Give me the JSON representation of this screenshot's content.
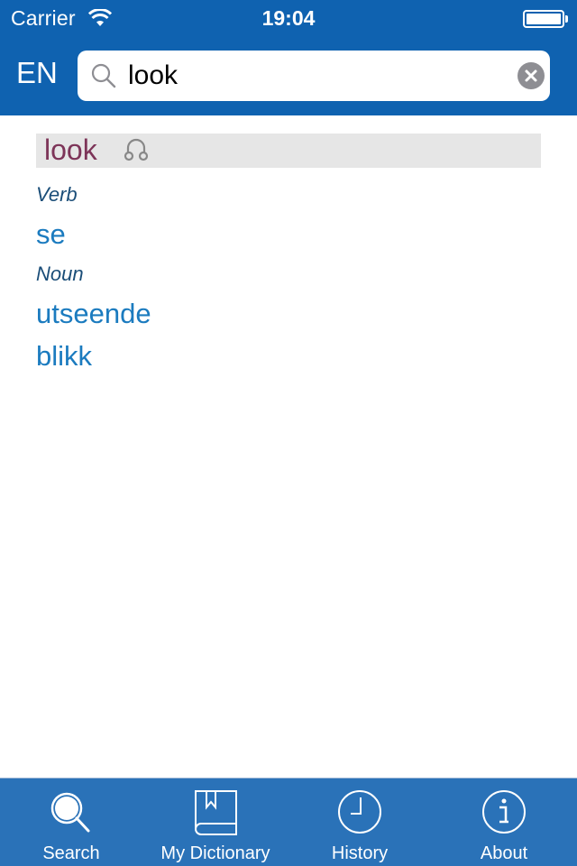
{
  "status_bar": {
    "carrier": "Carrier",
    "time": "19:04",
    "wifi_icon": "wifi-icon",
    "battery_icon": "battery-full-icon"
  },
  "header": {
    "language": "EN",
    "search": {
      "value": "look",
      "placeholder": "",
      "search_icon": "magnifier-icon",
      "clear_icon": "clear-circle-x-icon"
    }
  },
  "entry": {
    "headword": "look",
    "audio_icon": "headphones-icon",
    "senses": [
      {
        "part_of_speech": "Verb",
        "translations": [
          "se"
        ]
      },
      {
        "part_of_speech": "Noun",
        "translations": [
          "utseende",
          "blikk"
        ]
      }
    ]
  },
  "tabbar": {
    "tabs": [
      {
        "label": "Search",
        "icon": "search-icon",
        "active": true
      },
      {
        "label": "My Dictionary",
        "icon": "bookmarked-book-icon",
        "active": false
      },
      {
        "label": "History",
        "icon": "clock-icon",
        "active": false
      },
      {
        "label": "About",
        "icon": "info-icon",
        "active": false
      }
    ]
  },
  "colors": {
    "header_bg": "#0f62b0",
    "tabbar_bg": "#2a72b8",
    "headword": "#7d3458",
    "part_of_speech": "#1a4d78",
    "translation": "#1b7bbf",
    "entry_head_bg": "#e6e6e6"
  }
}
